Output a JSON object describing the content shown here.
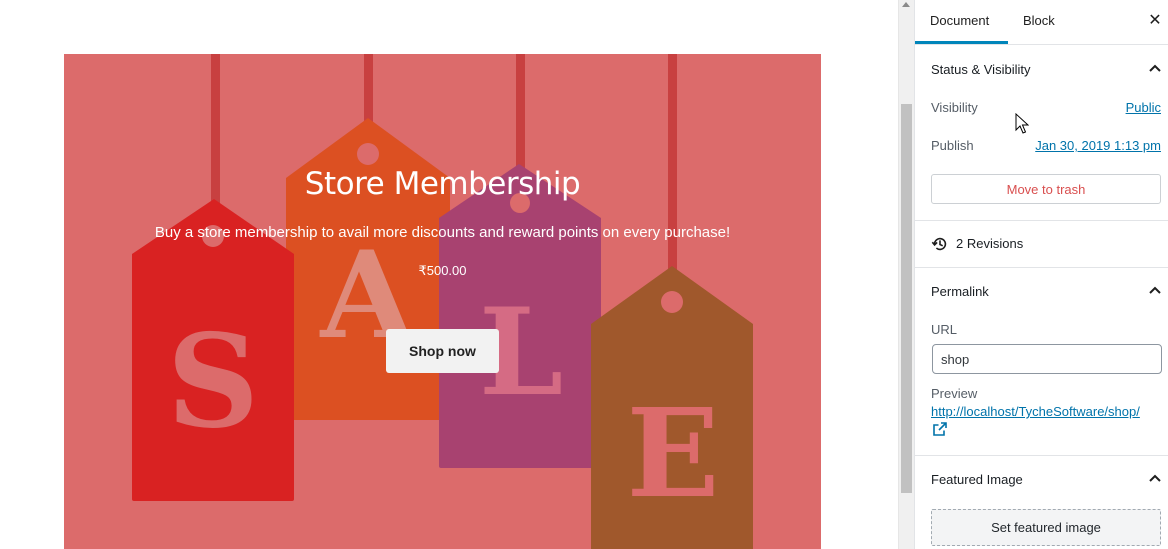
{
  "hero": {
    "title": "Store Membership",
    "description": "Buy a store membership to avail more discounts and reward points on every purchase!",
    "price": "₹500.00",
    "button_label": "Shop now",
    "background_letters": [
      "S",
      "A",
      "L",
      "E"
    ],
    "colors": {
      "background": "#dc6b6b",
      "tag_red": "#d92222",
      "tag_orange": "#dc5022",
      "tag_purple": "#a84270",
      "tag_brown": "#a0582c"
    }
  },
  "sidebar": {
    "tabs": [
      {
        "label": "Document",
        "active": true
      },
      {
        "label": "Block",
        "active": false
      }
    ],
    "close_icon": "close-icon",
    "status_visibility": {
      "title": "Status & Visibility",
      "visibility_label": "Visibility",
      "visibility_value": "Public",
      "publish_label": "Publish",
      "publish_value": "Jan 30, 2019 1:13 pm",
      "trash_label": "Move to trash"
    },
    "revisions": {
      "icon": "history-icon",
      "label": "2 Revisions"
    },
    "permalink": {
      "title": "Permalink",
      "url_label": "URL",
      "url_value": "shop",
      "preview_label": "Preview",
      "preview_link": "http://localhost/TycheSoftware/shop/",
      "external_icon": "external-link-icon"
    },
    "featured_image": {
      "title": "Featured Image",
      "button_label": "Set featured image"
    },
    "accent_color": "#0085ba",
    "link_color": "#0073aa",
    "danger_color": "#d94f4f"
  }
}
